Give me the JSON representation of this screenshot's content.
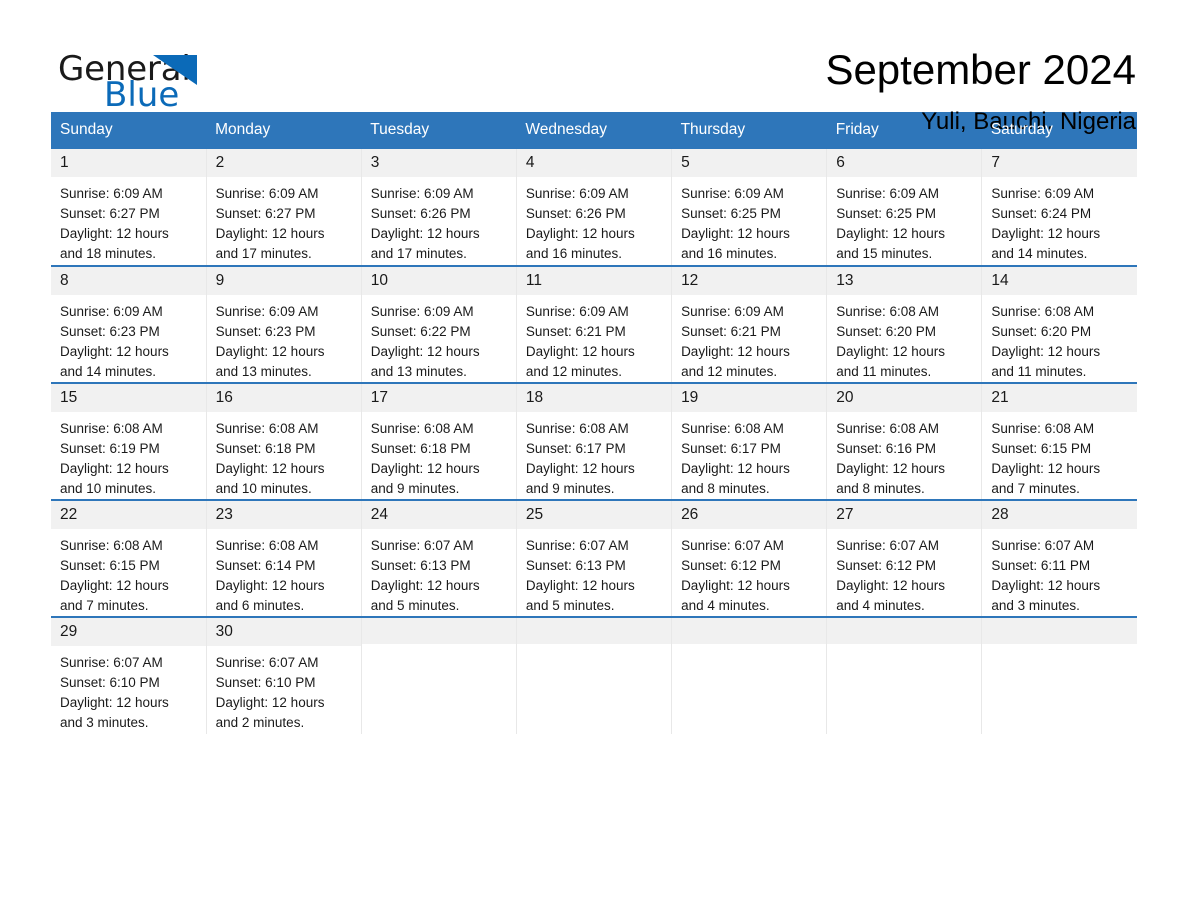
{
  "brand": {
    "name_part1": "General",
    "name_part2": "Blue",
    "triangle_color": "#0b6ab8"
  },
  "header": {
    "month_title": "September 2024",
    "location": "Yuli, Bauchi, Nigeria"
  },
  "theme": {
    "header_blue": "#2e76ba",
    "daynum_band": "#f1f1f1",
    "text": "#1a1a1a"
  },
  "calendar": {
    "weekday_headers": [
      "Sunday",
      "Monday",
      "Tuesday",
      "Wednesday",
      "Thursday",
      "Friday",
      "Saturday"
    ],
    "weeks": [
      [
        {
          "day": "1",
          "sunrise": "Sunrise: 6:09 AM",
          "sunset": "Sunset: 6:27 PM",
          "daylight_line1": "Daylight: 12 hours",
          "daylight_line2": "and 18 minutes."
        },
        {
          "day": "2",
          "sunrise": "Sunrise: 6:09 AM",
          "sunset": "Sunset: 6:27 PM",
          "daylight_line1": "Daylight: 12 hours",
          "daylight_line2": "and 17 minutes."
        },
        {
          "day": "3",
          "sunrise": "Sunrise: 6:09 AM",
          "sunset": "Sunset: 6:26 PM",
          "daylight_line1": "Daylight: 12 hours",
          "daylight_line2": "and 17 minutes."
        },
        {
          "day": "4",
          "sunrise": "Sunrise: 6:09 AM",
          "sunset": "Sunset: 6:26 PM",
          "daylight_line1": "Daylight: 12 hours",
          "daylight_line2": "and 16 minutes."
        },
        {
          "day": "5",
          "sunrise": "Sunrise: 6:09 AM",
          "sunset": "Sunset: 6:25 PM",
          "daylight_line1": "Daylight: 12 hours",
          "daylight_line2": "and 16 minutes."
        },
        {
          "day": "6",
          "sunrise": "Sunrise: 6:09 AM",
          "sunset": "Sunset: 6:25 PM",
          "daylight_line1": "Daylight: 12 hours",
          "daylight_line2": "and 15 minutes."
        },
        {
          "day": "7",
          "sunrise": "Sunrise: 6:09 AM",
          "sunset": "Sunset: 6:24 PM",
          "daylight_line1": "Daylight: 12 hours",
          "daylight_line2": "and 14 minutes."
        }
      ],
      [
        {
          "day": "8",
          "sunrise": "Sunrise: 6:09 AM",
          "sunset": "Sunset: 6:23 PM",
          "daylight_line1": "Daylight: 12 hours",
          "daylight_line2": "and 14 minutes."
        },
        {
          "day": "9",
          "sunrise": "Sunrise: 6:09 AM",
          "sunset": "Sunset: 6:23 PM",
          "daylight_line1": "Daylight: 12 hours",
          "daylight_line2": "and 13 minutes."
        },
        {
          "day": "10",
          "sunrise": "Sunrise: 6:09 AM",
          "sunset": "Sunset: 6:22 PM",
          "daylight_line1": "Daylight: 12 hours",
          "daylight_line2": "and 13 minutes."
        },
        {
          "day": "11",
          "sunrise": "Sunrise: 6:09 AM",
          "sunset": "Sunset: 6:21 PM",
          "daylight_line1": "Daylight: 12 hours",
          "daylight_line2": "and 12 minutes."
        },
        {
          "day": "12",
          "sunrise": "Sunrise: 6:09 AM",
          "sunset": "Sunset: 6:21 PM",
          "daylight_line1": "Daylight: 12 hours",
          "daylight_line2": "and 12 minutes."
        },
        {
          "day": "13",
          "sunrise": "Sunrise: 6:08 AM",
          "sunset": "Sunset: 6:20 PM",
          "daylight_line1": "Daylight: 12 hours",
          "daylight_line2": "and 11 minutes."
        },
        {
          "day": "14",
          "sunrise": "Sunrise: 6:08 AM",
          "sunset": "Sunset: 6:20 PM",
          "daylight_line1": "Daylight: 12 hours",
          "daylight_line2": "and 11 minutes."
        }
      ],
      [
        {
          "day": "15",
          "sunrise": "Sunrise: 6:08 AM",
          "sunset": "Sunset: 6:19 PM",
          "daylight_line1": "Daylight: 12 hours",
          "daylight_line2": "and 10 minutes."
        },
        {
          "day": "16",
          "sunrise": "Sunrise: 6:08 AM",
          "sunset": "Sunset: 6:18 PM",
          "daylight_line1": "Daylight: 12 hours",
          "daylight_line2": "and 10 minutes."
        },
        {
          "day": "17",
          "sunrise": "Sunrise: 6:08 AM",
          "sunset": "Sunset: 6:18 PM",
          "daylight_line1": "Daylight: 12 hours",
          "daylight_line2": "and 9 minutes."
        },
        {
          "day": "18",
          "sunrise": "Sunrise: 6:08 AM",
          "sunset": "Sunset: 6:17 PM",
          "daylight_line1": "Daylight: 12 hours",
          "daylight_line2": "and 9 minutes."
        },
        {
          "day": "19",
          "sunrise": "Sunrise: 6:08 AM",
          "sunset": "Sunset: 6:17 PM",
          "daylight_line1": "Daylight: 12 hours",
          "daylight_line2": "and 8 minutes."
        },
        {
          "day": "20",
          "sunrise": "Sunrise: 6:08 AM",
          "sunset": "Sunset: 6:16 PM",
          "daylight_line1": "Daylight: 12 hours",
          "daylight_line2": "and 8 minutes."
        },
        {
          "day": "21",
          "sunrise": "Sunrise: 6:08 AM",
          "sunset": "Sunset: 6:15 PM",
          "daylight_line1": "Daylight: 12 hours",
          "daylight_line2": "and 7 minutes."
        }
      ],
      [
        {
          "day": "22",
          "sunrise": "Sunrise: 6:08 AM",
          "sunset": "Sunset: 6:15 PM",
          "daylight_line1": "Daylight: 12 hours",
          "daylight_line2": "and 7 minutes."
        },
        {
          "day": "23",
          "sunrise": "Sunrise: 6:08 AM",
          "sunset": "Sunset: 6:14 PM",
          "daylight_line1": "Daylight: 12 hours",
          "daylight_line2": "and 6 minutes."
        },
        {
          "day": "24",
          "sunrise": "Sunrise: 6:07 AM",
          "sunset": "Sunset: 6:13 PM",
          "daylight_line1": "Daylight: 12 hours",
          "daylight_line2": "and 5 minutes."
        },
        {
          "day": "25",
          "sunrise": "Sunrise: 6:07 AM",
          "sunset": "Sunset: 6:13 PM",
          "daylight_line1": "Daylight: 12 hours",
          "daylight_line2": "and 5 minutes."
        },
        {
          "day": "26",
          "sunrise": "Sunrise: 6:07 AM",
          "sunset": "Sunset: 6:12 PM",
          "daylight_line1": "Daylight: 12 hours",
          "daylight_line2": "and 4 minutes."
        },
        {
          "day": "27",
          "sunrise": "Sunrise: 6:07 AM",
          "sunset": "Sunset: 6:12 PM",
          "daylight_line1": "Daylight: 12 hours",
          "daylight_line2": "and 4 minutes."
        },
        {
          "day": "28",
          "sunrise": "Sunrise: 6:07 AM",
          "sunset": "Sunset: 6:11 PM",
          "daylight_line1": "Daylight: 12 hours",
          "daylight_line2": "and 3 minutes."
        }
      ],
      [
        {
          "day": "29",
          "sunrise": "Sunrise: 6:07 AM",
          "sunset": "Sunset: 6:10 PM",
          "daylight_line1": "Daylight: 12 hours",
          "daylight_line2": "and 3 minutes."
        },
        {
          "day": "30",
          "sunrise": "Sunrise: 6:07 AM",
          "sunset": "Sunset: 6:10 PM",
          "daylight_line1": "Daylight: 12 hours",
          "daylight_line2": "and 2 minutes."
        },
        {
          "day": "",
          "sunrise": "",
          "sunset": "",
          "daylight_line1": "",
          "daylight_line2": ""
        },
        {
          "day": "",
          "sunrise": "",
          "sunset": "",
          "daylight_line1": "",
          "daylight_line2": ""
        },
        {
          "day": "",
          "sunrise": "",
          "sunset": "",
          "daylight_line1": "",
          "daylight_line2": ""
        },
        {
          "day": "",
          "sunrise": "",
          "sunset": "",
          "daylight_line1": "",
          "daylight_line2": ""
        },
        {
          "day": "",
          "sunrise": "",
          "sunset": "",
          "daylight_line1": "",
          "daylight_line2": ""
        }
      ]
    ]
  }
}
